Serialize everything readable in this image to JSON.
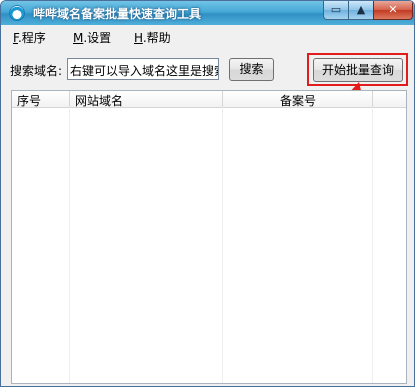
{
  "window": {
    "title": "哔哔域名备案批量快速查询工具",
    "controls": {
      "minimize": "▭",
      "maximize": "▲",
      "close": "✕"
    }
  },
  "menu": {
    "items": [
      {
        "accel": "F",
        "label": ".程序"
      },
      {
        "accel": "M",
        "label": ".设置"
      },
      {
        "accel": "H",
        "label": ".帮助"
      }
    ]
  },
  "search": {
    "label": "搜索域名:",
    "value": "右键可以导入域名这里是搜索",
    "button": "搜索"
  },
  "batch_button": "开始批量查询",
  "table": {
    "columns": [
      "序号",
      "网站域名",
      "备案号"
    ],
    "rows": []
  },
  "colors": {
    "highlight": "#e31b1b",
    "titlebar": "#45a8d6"
  }
}
